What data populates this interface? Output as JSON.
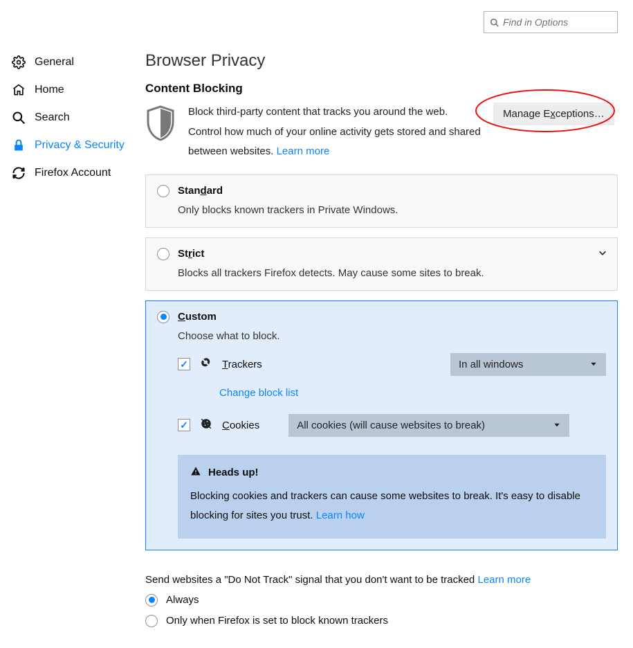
{
  "search": {
    "placeholder": "Find in Options"
  },
  "sidebar": {
    "items": [
      {
        "label": "General"
      },
      {
        "label": "Home"
      },
      {
        "label": "Search"
      },
      {
        "label": "Privacy & Security"
      },
      {
        "label": "Firefox Account"
      }
    ]
  },
  "page": {
    "title": "Browser Privacy",
    "section": "Content Blocking",
    "description": "Block third-party content that tracks you around the web. Control how much of your online activity gets stored and shared between websites.  ",
    "learn_more": "Learn more",
    "manage_exceptions": "Manage Exceptions…"
  },
  "options": {
    "standard": {
      "label_pre": "Stan",
      "label_ul": "d",
      "label_post": "ard",
      "sub": "Only blocks known trackers in Private Windows."
    },
    "strict": {
      "label_pre": "St",
      "label_ul": "r",
      "label_post": "ict",
      "sub": "Blocks all trackers Firefox detects. May cause some sites to break."
    },
    "custom": {
      "label_ul": "C",
      "label_post": "ustom",
      "sub": "Choose what to block."
    }
  },
  "custom": {
    "trackers_label_ul": "T",
    "trackers_label_post": "rackers",
    "trackers_dropdown": "In all windows",
    "change_block_list": "Change block list",
    "cookies_label_ul": "C",
    "cookies_label_post": "ookies",
    "cookies_dropdown": "All cookies (will cause websites to break)"
  },
  "notice": {
    "heading": "Heads up!",
    "body": "Blocking cookies and trackers can cause some websites to break. It's easy to disable blocking for sites you trust.  ",
    "learn_how": "Learn how"
  },
  "dnt": {
    "text": "Send websites a \"Do Not Track\" signal that you don't want to be tracked  ",
    "learn_more": "Learn more",
    "always": "Always",
    "only_when": "Only when Firefox is set to block known trackers"
  }
}
